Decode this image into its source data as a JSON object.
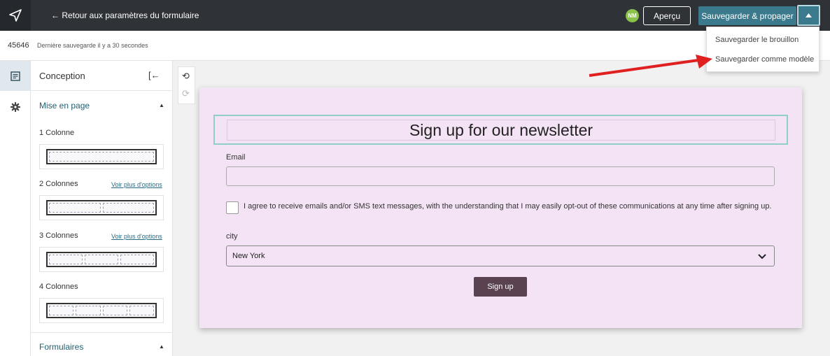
{
  "topbar": {
    "logo_icon": "send-paper-plane-icon",
    "back_label": "← Retour aux paramètres du formulaire",
    "avatar_initials": "NM",
    "avatar_color": "#8bc34a",
    "preview_label": "Aperçu",
    "save_label": "Sauvegarder & propager",
    "save_color": "#3a7a8c",
    "caret_icon": "caret-up-icon"
  },
  "save_menu": {
    "items": [
      "Sauvegarder le brouillon",
      "Sauvegarder comme modèle"
    ]
  },
  "subbar": {
    "form_id": "45646",
    "last_saved": "Dernière sauvegarde il y a 30 secondes"
  },
  "rail": {
    "items": [
      {
        "icon": "form-design-icon",
        "active": true
      },
      {
        "icon": "gear-icon",
        "active": false
      }
    ]
  },
  "panel": {
    "title": "Conception",
    "collapse_icon": "collapse-left-icon",
    "layout_section": "Mise en page",
    "layouts": [
      {
        "label": "1 Colonne",
        "columns": 1,
        "more_link": ""
      },
      {
        "label": "2 Colonnes",
        "columns": 2,
        "more_link": "Voir plus d'options"
      },
      {
        "label": "3 Colonnes",
        "columns": 3,
        "more_link": "Voir plus d'options"
      },
      {
        "label": "4 Colonnes",
        "columns": 4,
        "more_link": ""
      }
    ],
    "forms_section": "Formulaires"
  },
  "form": {
    "background": "#f3e3f4",
    "title": "Sign up for our newsletter",
    "email_label": "Email",
    "email_value": "",
    "consent_text": "I agree to receive emails and/or SMS text messages, with the understanding that I may easily opt-out of these communications at any time after signing up.",
    "consent_checked": false,
    "city_label": "city",
    "city_value": "New York",
    "submit_label": "Sign up",
    "submit_color": "#5a4250"
  },
  "annotation": {
    "arrow_color": "#e02020"
  }
}
